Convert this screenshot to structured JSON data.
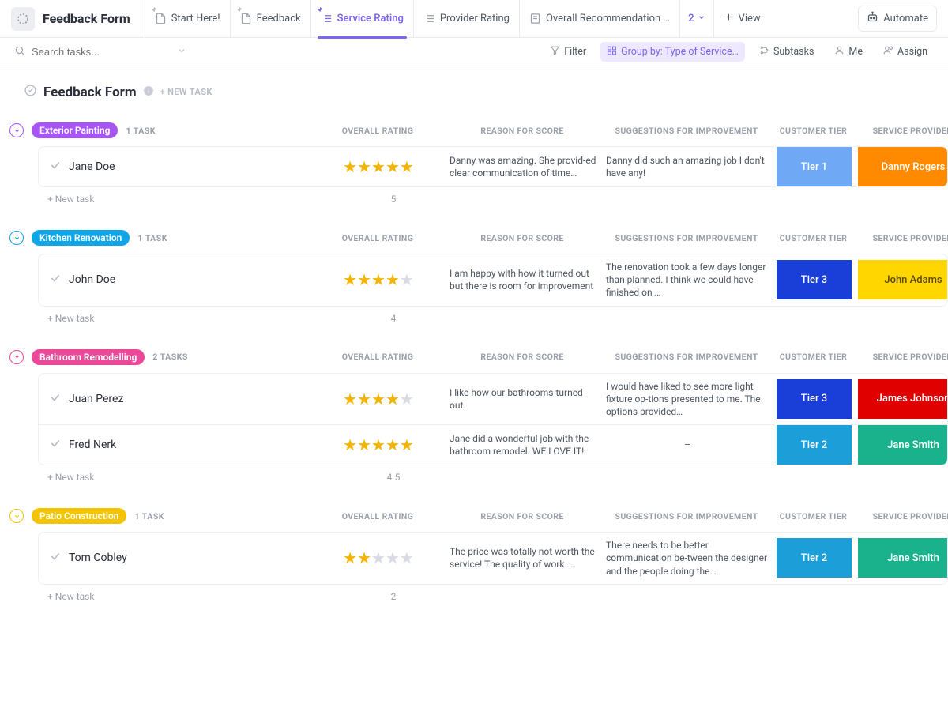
{
  "header": {
    "title": "Feedback Form",
    "tabs": [
      {
        "label": "Start Here!"
      },
      {
        "label": "Feedback"
      },
      {
        "label": "Service Rating"
      },
      {
        "label": "Provider Rating"
      },
      {
        "label": "Overall Recommendation …"
      }
    ],
    "more_count": "2",
    "view_button": "View",
    "automate_button": "Automate"
  },
  "toolbar": {
    "search_placeholder": "Search tasks...",
    "filter": "Filter",
    "group_by": "Group by: Type of Service…",
    "subtasks": "Subtasks",
    "me": "Me",
    "assign": "Assign"
  },
  "list": {
    "name": "Feedback Form",
    "new_task_label": "+ NEW TASK",
    "row_new_task": "+ New task"
  },
  "columns": {
    "rating": "OVERALL RATING",
    "reason": "REASON FOR SCORE",
    "suggestions": "SUGGESTIONS FOR IMPROVEMENT",
    "tier": "CUSTOMER TIER",
    "provider": "SERVICE PROVIDER"
  },
  "groups": [
    {
      "name": "Exterior Painting",
      "chip_color": "#a855f7",
      "chevron_color": "#a855f7",
      "count": "1 TASK",
      "avg": "5",
      "tasks": [
        {
          "name": "Jane Doe",
          "stars": 5,
          "reason": "Danny was amazing. She provid-ed clear communication of time…",
          "suggestions": "Danny did such an amazing job I don't have any!",
          "tier": "Tier 1",
          "tier_cls": "tier-blue",
          "provider": "Danny Rogers",
          "prov_cls": "prov-orange"
        }
      ]
    },
    {
      "name": "Kitchen Renovation",
      "chip_color": "#0ea5e9",
      "chevron_color": "#0ea5e9",
      "count": "1 TASK",
      "avg": "4",
      "tasks": [
        {
          "name": "John Doe",
          "stars": 4,
          "reason": "I am happy with how it turned out but there is room for improvement",
          "suggestions": "The renovation took a few days longer than planned. I think we could have finished on …",
          "tier": "Tier 3",
          "tier_cls": "tier-dblue",
          "provider": "John Adams",
          "prov_cls": "prov-yellow"
        }
      ]
    },
    {
      "name": "Bathroom Remodelling",
      "chip_color": "#ec4899",
      "chevron_color": "#ec4899",
      "count": "2 TASKS",
      "avg": "4.5",
      "tasks": [
        {
          "name": "Juan Perez",
          "stars": 4,
          "reason": "I like how our bathrooms turned out.",
          "suggestions": "I would have liked to see more light fixture op-tions presented to me. The options provided…",
          "tier": "Tier 3",
          "tier_cls": "tier-dblue",
          "provider": "James Johnson",
          "prov_cls": "prov-red"
        },
        {
          "name": "Fred Nerk",
          "stars": 5,
          "reason": "Jane did a wonderful job with the bathroom remodel. WE LOVE IT!",
          "suggestions": "–",
          "suggestions_center": true,
          "tier": "Tier 2",
          "tier_cls": "tier-cyan",
          "provider": "Jane Smith",
          "prov_cls": "prov-teal"
        }
      ]
    },
    {
      "name": "Patio Construction",
      "chip_color": "#f5c400",
      "chevron_color": "#f5c400",
      "count": "1 TASK",
      "avg": "2",
      "tasks": [
        {
          "name": "Tom Cobley",
          "stars": 2,
          "reason": "The price was totally not worth the service! The quality of work …",
          "suggestions": "There needs to be better communication be-tween the designer and the people doing the…",
          "tier": "Tier 2",
          "tier_cls": "tier-cyan",
          "provider": "Jane Smith",
          "prov_cls": "prov-teal"
        }
      ]
    }
  ]
}
